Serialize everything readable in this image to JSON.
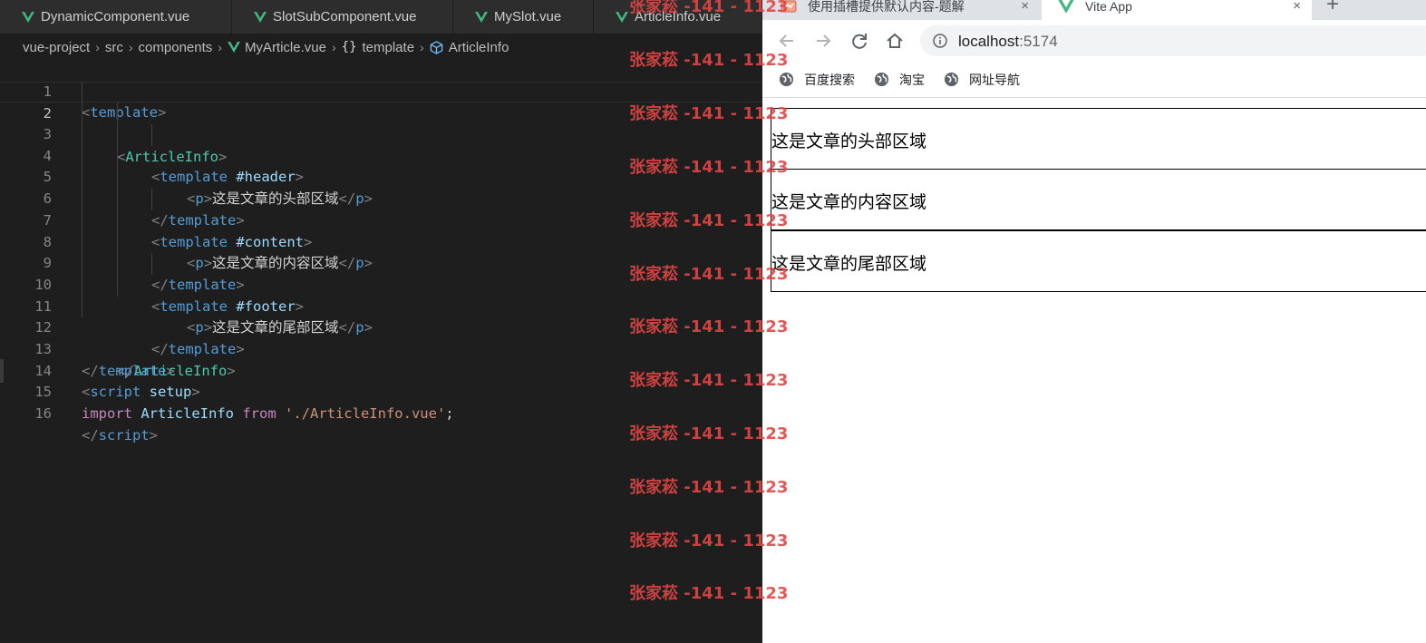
{
  "editor": {
    "tabs": [
      "DynamicComponent.vue",
      "SlotSubComponent.vue",
      "MySlot.vue",
      "ArticleInfo.vue"
    ],
    "breadcrumb": {
      "project": "vue-project",
      "src": "src",
      "folder": "components",
      "file": "MyArticle.vue",
      "section": "template",
      "symbol": "ArticleInfo"
    },
    "line_numbers": [
      "1",
      "2",
      "3",
      "4",
      "5",
      "6",
      "7",
      "8",
      "9",
      "10",
      "11",
      "12",
      "13",
      "14",
      "15",
      "16"
    ],
    "current_line": "2",
    "code": {
      "l1": [
        "<",
        "template",
        ">"
      ],
      "l2": [
        "<",
        "ArticleInfo",
        ">"
      ],
      "l3": [
        "<",
        "template",
        " #header",
        ">"
      ],
      "l4": [
        "<",
        "p",
        ">",
        "这是文章的头部区域",
        "</",
        "p",
        ">"
      ],
      "l5": [
        "</",
        "template",
        ">"
      ],
      "l6": [
        "<",
        "template",
        " #content",
        ">"
      ],
      "l7": [
        "<",
        "p",
        ">",
        "这是文章的内容区域",
        "</",
        "p",
        ">"
      ],
      "l8": [
        "</",
        "template",
        ">"
      ],
      "l9": [
        "<",
        "template",
        " #footer",
        ">"
      ],
      "l10": [
        "<",
        "p",
        ">",
        "这是文章的尾部区域",
        "</",
        "p",
        ">"
      ],
      "l11": [
        "</",
        "template",
        ">"
      ],
      "l12": [
        "</",
        "ArticleInfo",
        ">"
      ],
      "l13": [
        "</",
        "template",
        ">"
      ],
      "l14": [
        "<",
        "script",
        " setup",
        ">"
      ],
      "l15": [
        "import",
        " ArticleInfo ",
        "from",
        " './ArticleInfo.vue'",
        ";"
      ],
      "l16": [
        "</",
        "script",
        ">"
      ]
    }
  },
  "browser": {
    "tabs": [
      {
        "title": "使用插槽提供默认内容-题解",
        "close": "×"
      },
      {
        "title": "Vite App",
        "close": "×"
      }
    ],
    "new_tab": "+",
    "url_host": "localhost",
    "url_port": ":5174",
    "bookmarks": [
      "百度搜索",
      "淘宝",
      "网址导航"
    ],
    "content": [
      "这是文章的头部区域",
      "这是文章的内容区域",
      "这是文章的尾部区域"
    ]
  },
  "watermark": "张家菘 -141 - 1123",
  "colors": {
    "editor_bg": "#1e1e1e",
    "tag": "#569cd6",
    "component": "#4ec9b0",
    "attribute": "#9cdcfe",
    "keyword": "#c586c0",
    "string": "#ce9178",
    "vue_green": "#41b883",
    "watermark": "#e24545"
  }
}
